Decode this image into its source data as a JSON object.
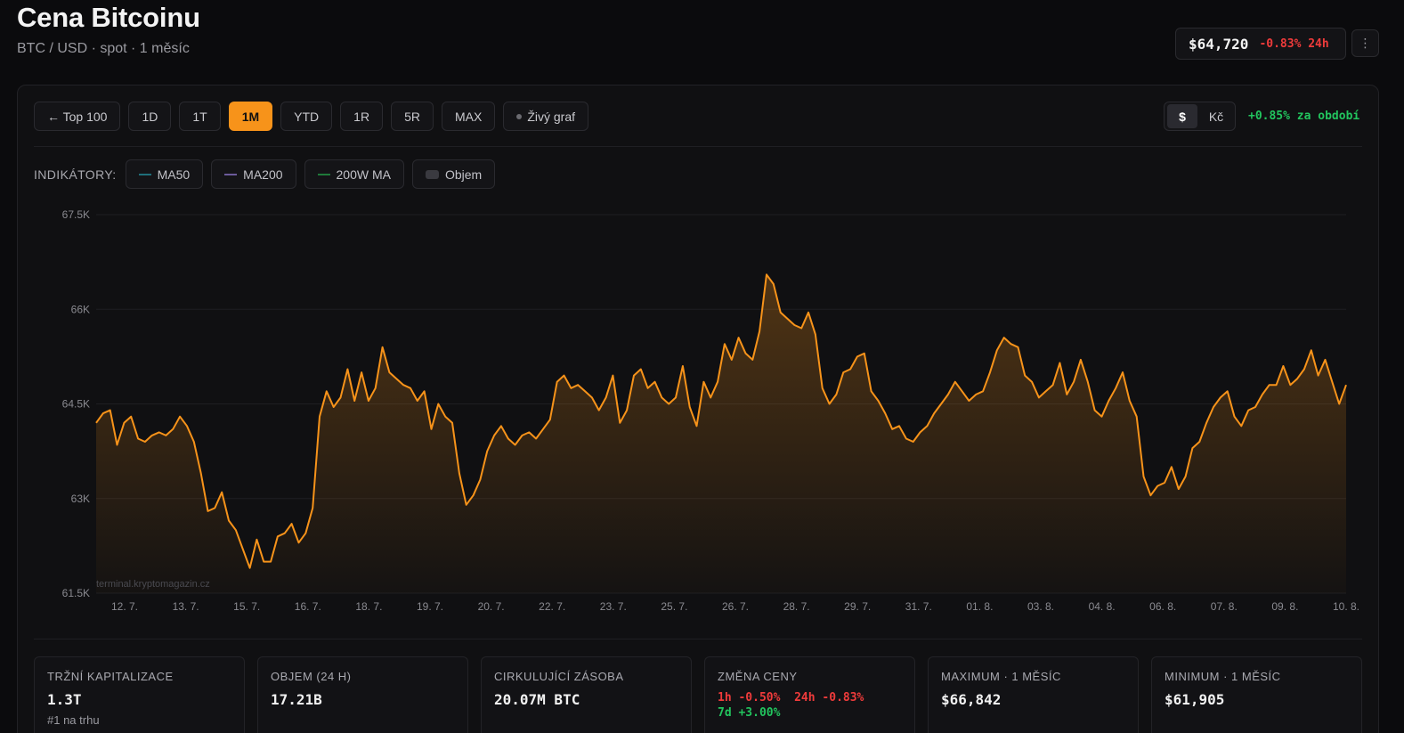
{
  "header": {
    "title": "Cena Bitcoinu",
    "subtitle": "BTC / USD · spot · 1 měsíc",
    "price": "$64,720",
    "price_change": "-0.83% 24h",
    "more_icon": "⋮"
  },
  "toolbar": {
    "back": "← Top 100",
    "ranges": [
      "1D",
      "1T",
      "1M",
      "YTD",
      "1R",
      "5R",
      "MAX"
    ],
    "active_range": "1M",
    "live": "Živý graf",
    "currency_usd": "$",
    "currency_czk": "Kč",
    "period_change": "+0.85% za období"
  },
  "indicators": {
    "label": "INDIKÁTORY:",
    "ma50": "MA50",
    "ma200": "MA200",
    "ma200w": "200W MA",
    "volume": "Objem"
  },
  "colors": {
    "accent": "#f7931a",
    "negative": "#ef3b3b",
    "positive": "#22c55e",
    "ma50": "#1f6f7a",
    "ma200": "#6b5a9a",
    "ma200w": "#1f7a3a"
  },
  "chart_data": {
    "type": "area",
    "series": [
      {
        "name": "BTC / USD"
      }
    ],
    "watermark": "terminal.kryptomagazin.cz",
    "ylim": [
      61500,
      67500
    ],
    "yticks": [
      "67.5K",
      "66K",
      "64.5K",
      "63K",
      "61.5K"
    ],
    "ytick_values": [
      67500,
      66000,
      64500,
      63000,
      61500
    ],
    "xticks": [
      "12. 7.",
      "13. 7.",
      "15. 7.",
      "16. 7.",
      "18. 7.",
      "19. 7.",
      "20. 7.",
      "22. 7.",
      "23. 7.",
      "25. 7.",
      "26. 7.",
      "28. 7.",
      "29. 7.",
      "31. 7.",
      "01. 8.",
      "03. 8.",
      "04. 8.",
      "06. 8.",
      "07. 8.",
      "09. 8.",
      "10. 8."
    ],
    "grid": true,
    "x": [
      0,
      1,
      2,
      3,
      4,
      5,
      6,
      7,
      8,
      9,
      10,
      11,
      12,
      13,
      14,
      15,
      16,
      17,
      18,
      19,
      20,
      21,
      22,
      23,
      24,
      25,
      26,
      27,
      28,
      29,
      30,
      31,
      32,
      33,
      34,
      35,
      36,
      37,
      38,
      39,
      40,
      41,
      42,
      43,
      44,
      45,
      46,
      47,
      48,
      49,
      50,
      51,
      52,
      53,
      54,
      55,
      56,
      57,
      58,
      59,
      60,
      61,
      62,
      63,
      64,
      65,
      66,
      67,
      68,
      69,
      70,
      71,
      72,
      73,
      74,
      75,
      76,
      77,
      78,
      79,
      80,
      81,
      82,
      83,
      84,
      85,
      86,
      87,
      88,
      89,
      90,
      91,
      92,
      93,
      94,
      95,
      96,
      97,
      98,
      99,
      100,
      101,
      102,
      103,
      104,
      105,
      106,
      107,
      108,
      109,
      110,
      111,
      112,
      113,
      114,
      115,
      116,
      117,
      118,
      119,
      120,
      121,
      122,
      123,
      124,
      125,
      126,
      127,
      128,
      129,
      130,
      131,
      132,
      133,
      134,
      135,
      136,
      137,
      138,
      139,
      140,
      141,
      142,
      143,
      144,
      145,
      146,
      147,
      148,
      149,
      150,
      151,
      152,
      153,
      154,
      155,
      156,
      157,
      158,
      159,
      160,
      161,
      162,
      163,
      164,
      165,
      166,
      167,
      168,
      169,
      170,
      171,
      172,
      173,
      174,
      175,
      176,
      177,
      178,
      179,
      180
    ],
    "values": [
      64200,
      64350,
      64400,
      63850,
      64200,
      64300,
      63950,
      63900,
      64000,
      64050,
      64000,
      64100,
      64300,
      64150,
      63900,
      63400,
      62800,
      62850,
      63100,
      62650,
      62500,
      62200,
      61900,
      62350,
      62000,
      62000,
      62400,
      62450,
      62600,
      62300,
      62450,
      62850,
      64300,
      64700,
      64450,
      64600,
      65050,
      64550,
      65000,
      64550,
      64750,
      65400,
      65000,
      64900,
      64800,
      64750,
      64550,
      64700,
      64100,
      64500,
      64300,
      64200,
      63400,
      62900,
      63050,
      63300,
      63750,
      64000,
      64150,
      63950,
      63850,
      64000,
      64050,
      63950,
      64100,
      64250,
      64850,
      64950,
      64750,
      64800,
      64700,
      64600,
      64400,
      64600,
      64950,
      64200,
      64400,
      64950,
      65050,
      64750,
      64850,
      64600,
      64500,
      64600,
      65100,
      64450,
      64150,
      64850,
      64600,
      64850,
      65450,
      65200,
      65550,
      65300,
      65200,
      65650,
      66550,
      66400,
      65950,
      65850,
      65750,
      65700,
      65950,
      65600,
      64750,
      64500,
      64650,
      65000,
      65050,
      65250,
      65300,
      64700,
      64550,
      64350,
      64100,
      64150,
      63950,
      63900,
      64050,
      64150,
      64350,
      64500,
      64650,
      64850,
      64700,
      64550,
      64650,
      64700,
      65000,
      65350,
      65550,
      65450,
      65400,
      64950,
      64850,
      64600,
      64700,
      64800,
      65150,
      64650,
      64850,
      65200,
      64850,
      64400,
      64300,
      64550,
      64750,
      65000,
      64550,
      64300,
      63350,
      63050,
      63200,
      63250,
      63500,
      63150,
      63350,
      63800,
      63900,
      64200,
      64450,
      64600,
      64700,
      64300,
      64150,
      64400,
      64450,
      64650,
      64800,
      64800,
      65100,
      64800,
      64900,
      65050,
      65350,
      64950,
      65200,
      64850,
      64500,
      64800
    ],
    "highs": {
      "max": "$66,842",
      "min": "$61,905"
    }
  },
  "stats": [
    {
      "label": "Tržní kapitalizace",
      "value": "1.3T",
      "sub": "#1 na trhu"
    },
    {
      "label": "Objem (24 h)",
      "value": "17.21B"
    },
    {
      "label": "Cirkulující zásoba",
      "value": "20.07M BTC"
    },
    {
      "label": "Změna ceny",
      "c1h_label": "1h",
      "c1h": "-0.50%",
      "c24h_label": "24h",
      "c24h": "-0.83%",
      "c7d_label": "7d",
      "c7d": "+3.00%"
    },
    {
      "label": "Maximum · 1 měsíc",
      "value": "$66,842"
    },
    {
      "label": "Minimum · 1 měsíc",
      "value": "$61,905"
    }
  ]
}
